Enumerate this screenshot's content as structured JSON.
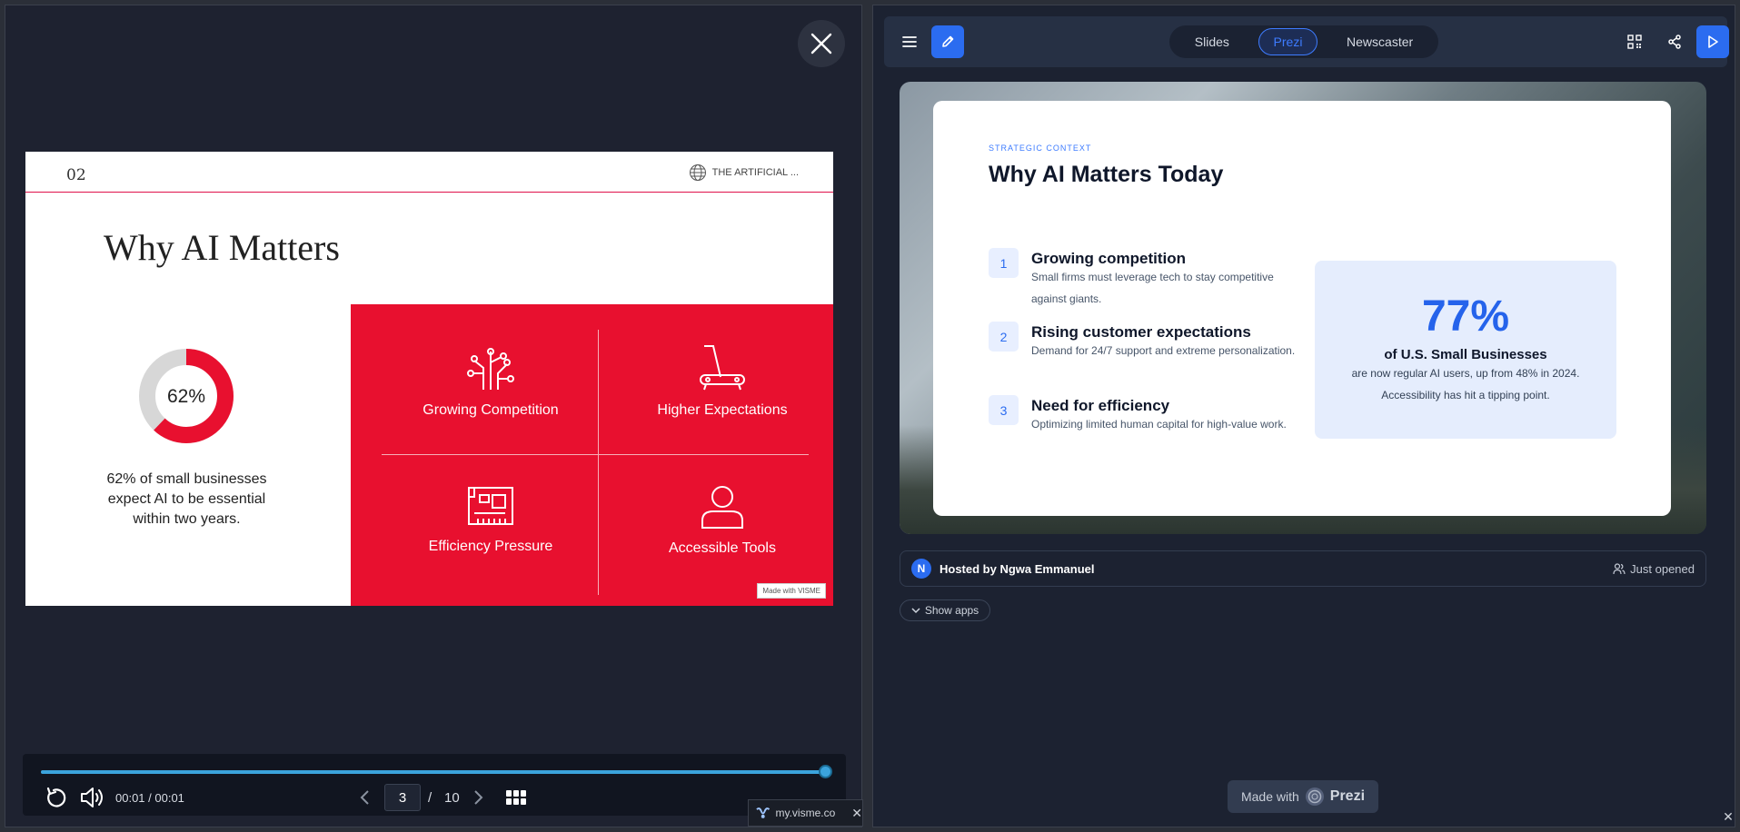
{
  "visme": {
    "slide": {
      "number": "02",
      "brand": "THE ARTIFICIAL ...",
      "title": "Why AI Matters",
      "donut_value": 62,
      "donut_label": "62%",
      "stat_text": "62% of small businesses expect AI to be essential within two years.",
      "cells": [
        {
          "label": "Growing Competition",
          "icon": "circuit-icon"
        },
        {
          "label": "Higher Expectations",
          "icon": "treadmill-icon"
        },
        {
          "label": "Efficiency Pressure",
          "icon": "chip-card-icon"
        },
        {
          "label": "Accessible Tools",
          "icon": "person-icon"
        }
      ],
      "made_with": "Made with VISME",
      "accent": "#e8102f"
    },
    "player": {
      "time": "00:01 / 00:01",
      "progress": 1.0,
      "current_page": "3",
      "separator": "/",
      "total_pages": "10"
    },
    "tab": {
      "label": "my.visme.co"
    }
  },
  "prezi": {
    "modes": [
      "Slides",
      "Prezi",
      "Newscaster"
    ],
    "active_mode": "Prezi",
    "card": {
      "eyebrow": "STRATEGIC CONTEXT",
      "title": "Why AI Matters Today",
      "points": [
        {
          "num": "1",
          "heading": "Growing competition",
          "desc": "Small firms must leverage tech to stay competitive against giants."
        },
        {
          "num": "2",
          "heading": "Rising customer expectations",
          "desc": "Demand for 24/7 support and extreme personalization."
        },
        {
          "num": "3",
          "heading": "Need for efficiency",
          "desc": "Optimizing limited human capital for high-value work."
        }
      ],
      "stat": {
        "value": "77%",
        "subtitle": "of U.S. Small Businesses",
        "line1": "are now regular AI users, up from 48% in 2024.",
        "line2": "Accessibility has hit a tipping point."
      }
    },
    "host": {
      "initial": "N",
      "label": "Hosted by Ngwa Emmanuel",
      "status": "Just opened"
    },
    "show_apps": "Show apps",
    "made_with": "Made with",
    "brand": "Prezi",
    "accent": "#2b6cf0"
  }
}
